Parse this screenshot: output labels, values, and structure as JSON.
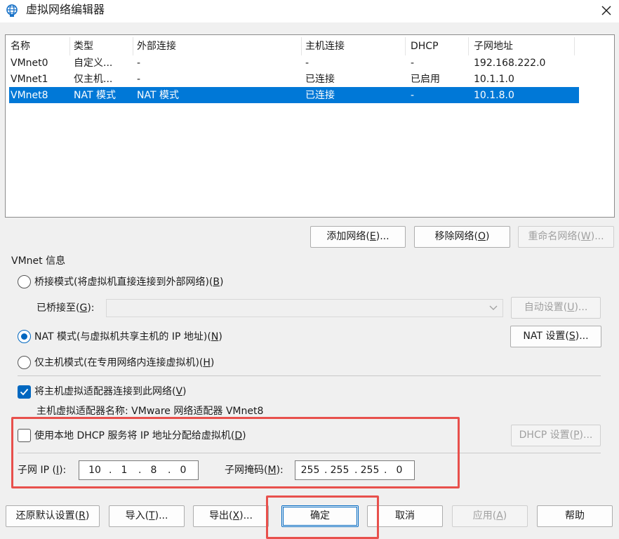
{
  "window": {
    "title": "虚拟网络编辑器"
  },
  "icons": {
    "app": "globe-icon",
    "close": "close-icon",
    "combo_arrow": "chevron-down-icon"
  },
  "colors": {
    "selection": "#0078d7",
    "accent": "#0067c0",
    "annotation": "#e8504c"
  },
  "list": {
    "columns": [
      "名称",
      "类型",
      "外部连接",
      "主机连接",
      "DHCP",
      "子网地址"
    ],
    "rows": [
      {
        "name": "VMnet0",
        "type": "自定义...",
        "external": "-",
        "host": "-",
        "dhcp": "-",
        "subnet": "192.168.222.0"
      },
      {
        "name": "VMnet1",
        "type": "仅主机...",
        "external": "-",
        "host": "已连接",
        "dhcp": "已启用",
        "subnet": "10.1.1.0"
      },
      {
        "name": "VMnet8",
        "type": "NAT 模式",
        "external": "NAT 模式",
        "host": "已连接",
        "dhcp": "-",
        "subnet": "10.1.8.0"
      }
    ],
    "selected_row": 2
  },
  "list_buttons": {
    "add": {
      "text": "添加网络(",
      "key": "E",
      "suffix": ")..."
    },
    "remove": {
      "text": "移除网络(",
      "key": "O",
      "suffix": ")"
    },
    "rename": {
      "text": "重命名网络(",
      "key": "W",
      "suffix": ")..."
    }
  },
  "vmnet_info": {
    "group_label": "VMnet 信息",
    "bridged": {
      "text": "桥接模式(将虚拟机直接连接到外部网络)(",
      "key": "B",
      "suffix": ")",
      "checked": false
    },
    "bridged_to": {
      "text": "已桥接至(",
      "key": "G",
      "suffix": "):"
    },
    "auto_settings": {
      "text": "自动设置(",
      "key": "U",
      "suffix": ")..."
    },
    "nat": {
      "text": "NAT 模式(与虚拟机共享主机的 IP 地址)(",
      "key": "N",
      "suffix": ")",
      "checked": true
    },
    "nat_settings": {
      "text": "NAT 设置(",
      "key": "S",
      "suffix": ")..."
    },
    "host_only": {
      "text": "仅主机模式(在专用网络内连接虚拟机)(",
      "key": "H",
      "suffix": ")",
      "checked": false
    },
    "connect_adapter": {
      "text": "将主机虚拟适配器连接到此网络(",
      "key": "V",
      "suffix": ")",
      "checked": true
    },
    "adapter_name": "主机虚拟适配器名称: VMware 网络适配器 VMnet8",
    "use_dhcp": {
      "text": "使用本地 DHCP 服务将 IP 地址分配给虚拟机(",
      "key": "D",
      "suffix": ")",
      "checked": false
    },
    "dhcp_settings": {
      "text": "DHCP 设置(",
      "key": "P",
      "suffix": ")..."
    },
    "subnet_ip": {
      "text": "子网 IP (",
      "key": "I",
      "suffix": "):",
      "octets": [
        "10",
        "1",
        "8",
        "0"
      ]
    },
    "subnet_mask": {
      "text": "子网掩码(",
      "key": "M",
      "suffix": "):",
      "octets": [
        "255",
        "255",
        "255",
        "0"
      ]
    }
  },
  "footer": {
    "restore": {
      "text": "还原默认设置(",
      "key": "R",
      "suffix": ")"
    },
    "import": {
      "text": "导入(",
      "key": "T",
      "suffix": ")..."
    },
    "export": {
      "text": "导出(",
      "key": "X",
      "suffix": ")..."
    },
    "ok": {
      "text": "确定"
    },
    "cancel": {
      "text": "取消"
    },
    "apply": {
      "text": "应用(",
      "key": "A",
      "suffix": ")"
    },
    "help": {
      "text": "帮助"
    }
  }
}
